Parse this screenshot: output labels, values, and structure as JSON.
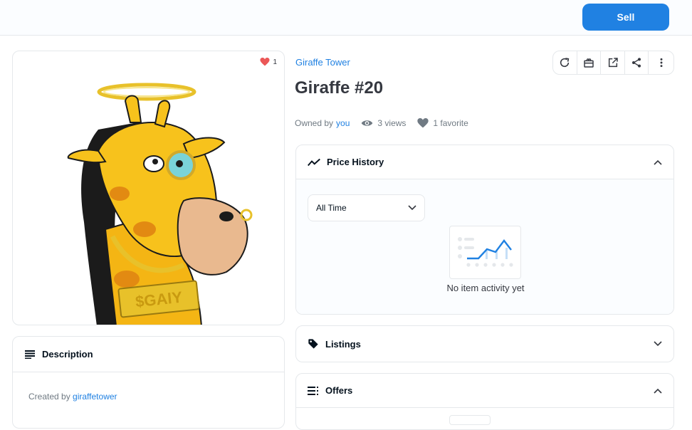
{
  "header": {
    "sell_label": "Sell"
  },
  "asset": {
    "favorite_count": "1",
    "collection": "Giraffe Tower",
    "title": "Giraffe #20",
    "owned_by_prefix": "Owned by",
    "owner": "you",
    "views": "3 views",
    "favorites": "1 favorite"
  },
  "toolbar": {
    "icons": [
      "refresh-icon",
      "transfer-icon",
      "external-link-icon",
      "share-icon",
      "more-icon"
    ]
  },
  "description": {
    "heading": "Description",
    "created_by_prefix": "Created by",
    "creator": "giraffetower"
  },
  "price_history": {
    "heading": "Price History",
    "range_selected": "All Time",
    "empty_text": "No item activity yet"
  },
  "listings": {
    "heading": "Listings"
  },
  "offers": {
    "heading": "Offers"
  },
  "colors": {
    "accent": "#2081e2",
    "favorite": "#eb5757",
    "border": "#e5e8eb"
  }
}
